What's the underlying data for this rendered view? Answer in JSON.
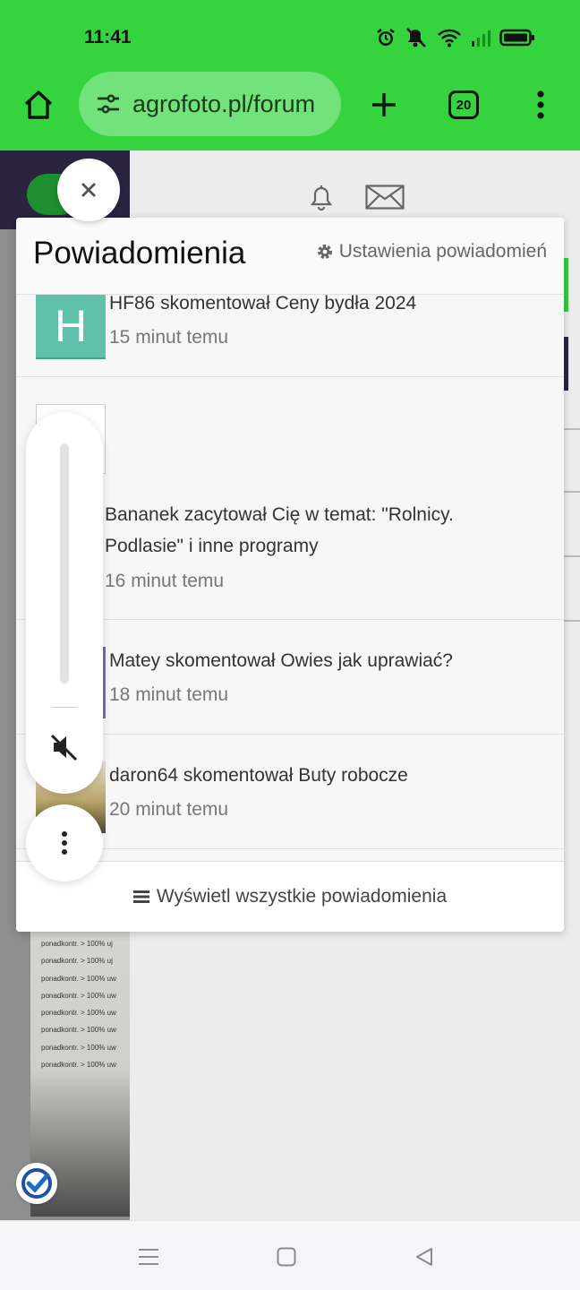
{
  "status_bar": {
    "time": "11:41",
    "icons": [
      "alarm-icon",
      "mute-icon",
      "wifi-icon",
      "signal-icon",
      "battery-icon"
    ]
  },
  "browser": {
    "url": "agrofoto.pl/forum",
    "tab_count": "20",
    "icons": [
      "home-icon",
      "site-settings-icon",
      "plus-icon",
      "tabs-icon",
      "more-vert-icon"
    ]
  },
  "panel": {
    "title": "Powiadomienia",
    "settings_label": "Ustawienia powiadomień",
    "footer_label": "Wyświetl wszystkie powiadomienia",
    "items": [
      {
        "avatar_letter": "H",
        "text": "HF86 skomentował Ceny bydła 2024",
        "time": "15 minut temu"
      },
      {
        "text": "Bananek zacytował Cię w temat: \"Rolnicy. Podlasie\" i inne programy",
        "time": "16 minut temu"
      },
      {
        "text": "Matey skomentował Owies jak uprawiać?",
        "time": "18 minut temu"
      },
      {
        "text": "daron64 skomentował Buty robocze",
        "time": "20 minut temu"
      }
    ]
  },
  "background_page": {
    "lines": [
      "ponadkontr. > 100% uj",
      "ponadkontr. > 100% uj",
      "ponadkontr. > 100% uw",
      "ponadkontr. > 100% uw",
      "ponadkontr. > 100% uw",
      "ponadkontr. > 100% uw",
      "ponadkontr. > 100% uw",
      "ponadkontr. > 100% uw"
    ]
  },
  "colors": {
    "toolbar_green": "#35d33e",
    "avatar_teal": "#5ec2ab",
    "site_dark": "#2a2440"
  }
}
